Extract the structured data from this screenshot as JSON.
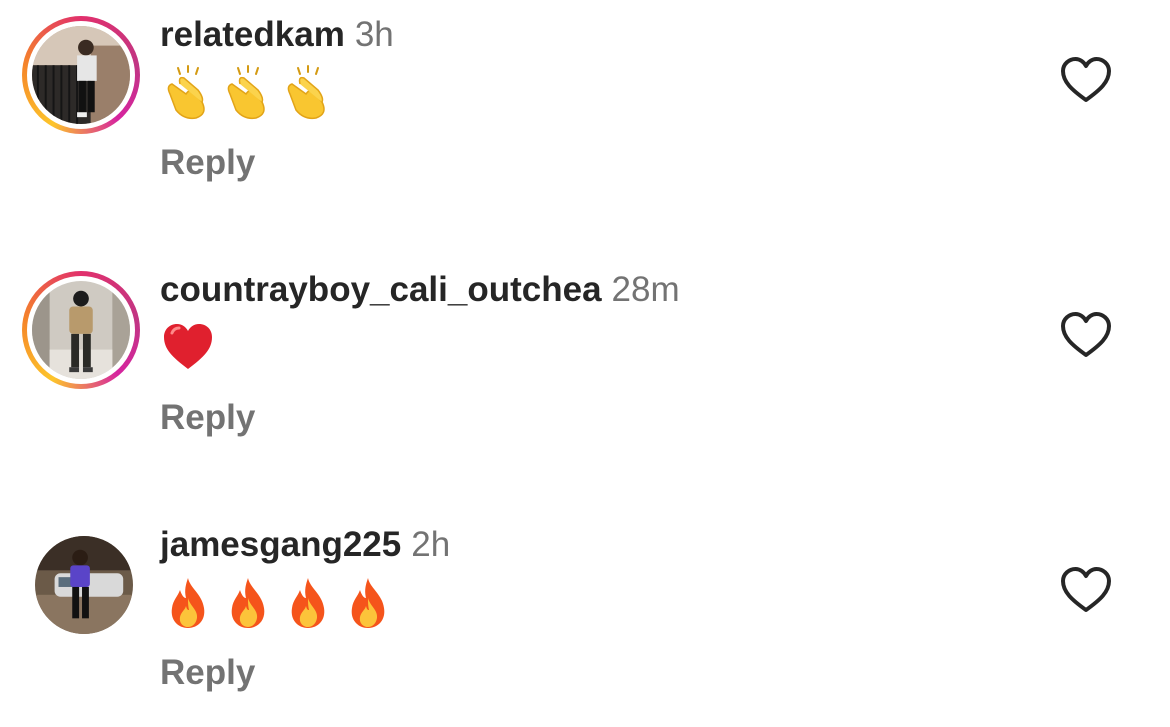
{
  "comments": [
    {
      "username": "relatedkam",
      "time": "3h",
      "message_icons": [
        "clapping-hands-icon",
        "clapping-hands-icon",
        "clapping-hands-icon"
      ],
      "reply_label": "Reply",
      "has_story_ring": true
    },
    {
      "username": "countrayboy_cali_outchea",
      "time": "28m",
      "message_icons": [
        "red-heart-icon"
      ],
      "reply_label": "Reply",
      "has_story_ring": true
    },
    {
      "username": "jamesgang225",
      "time": "2h",
      "message_icons": [
        "fire-icon",
        "fire-icon",
        "fire-icon",
        "fire-icon"
      ],
      "reply_label": "Reply",
      "has_story_ring": false
    }
  ],
  "colors": {
    "username": "#262626",
    "secondary_text": "#737373",
    "like_icon": "#262626",
    "heart_emoji": "#e0202e",
    "fire_emoji": "#f5541b",
    "clap_emoji": "#f9c630"
  }
}
